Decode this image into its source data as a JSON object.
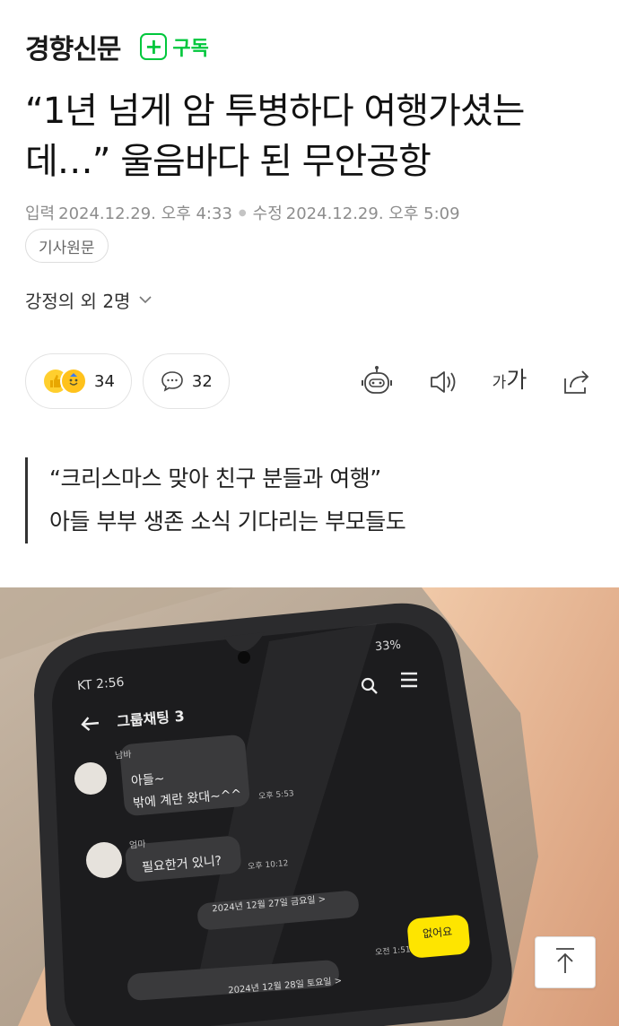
{
  "header": {
    "press_name": "경향신문",
    "subscribe_label": "구독"
  },
  "article": {
    "title": "“1년 넘게 암 투병하다 여행가셨는데…” 울음바다 된 무안공항",
    "published_label": "입력",
    "published": "2024.12.29. 오후 4:33",
    "modified_label": "수정",
    "modified": "2024.12.29. 오후 5:09",
    "original_link_label": "기사원문",
    "reporter": "강정의 외 2명",
    "quote_lines": [
      "“크리스마스 맞아 친구 분들과 여행”",
      "아들 부부 생존 소식 기다리는 부모들도"
    ]
  },
  "reactions": {
    "like_count": "34",
    "comment_count": "32"
  },
  "phone_screen": {
    "carrier_time": "KT 2:56",
    "status": "33%",
    "chat_title": "그룹채팅 3",
    "messages": [
      {
        "sender": "남바",
        "lines": [
          "아들~",
          "밖에 계란 왔대~^^"
        ],
        "time": "오후 5:53"
      },
      {
        "sender": "엄마",
        "lines": [
          "필요한거 있니?"
        ],
        "time": "오후 10:12"
      }
    ],
    "date_divider_1": "2024년 12월 27일 금요일 >",
    "my_message": "없어요",
    "my_time": "오전 1:51",
    "date_divider_2": "2024년 12월 28일 토요일 >"
  },
  "colors": {
    "accent": "#00c73c",
    "chat_yellow": "#fee500"
  },
  "icons": [
    "plus-icon",
    "chevron-down-icon",
    "comment-icon",
    "robot-summary-icon",
    "speaker-icon",
    "font-size-icon",
    "share-icon",
    "arrow-up-icon"
  ]
}
